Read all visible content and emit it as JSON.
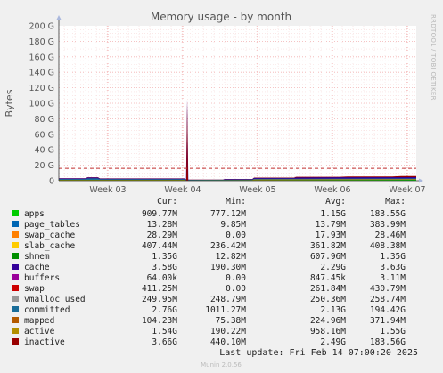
{
  "chart_data": {
    "type": "area",
    "title": "Memory usage - by month",
    "ylabel": "Bytes",
    "ylim": [
      0,
      200
    ],
    "y_unit": "G",
    "y_ticks": [
      "0",
      "20 G",
      "40 G",
      "60 G",
      "80 G",
      "100 G",
      "120 G",
      "140 G",
      "160 G",
      "180 G",
      "200 G"
    ],
    "x_ticks": [
      "Week 03",
      "Week 04",
      "Week 05",
      "Week 06",
      "Week 07"
    ],
    "threshold_line": 16,
    "grid": true,
    "side_label": "RRDTOOL / TOBI OETIKER",
    "columns": [
      "Cur:",
      "Min:",
      "Avg:",
      "Max:"
    ],
    "series": [
      {
        "name": "apps",
        "color": "#00cc00",
        "cur": "909.77M",
        "min": "777.12M",
        "avg": "1.15G",
        "max": "183.55G"
      },
      {
        "name": "page_tables",
        "color": "#0066b3",
        "cur": "13.28M",
        "min": "9.85M",
        "avg": "13.79M",
        "max": "383.99M"
      },
      {
        "name": "swap_cache",
        "color": "#ff8000",
        "cur": "28.29M",
        "min": "0.00",
        "avg": "17.93M",
        "max": "28.46M"
      },
      {
        "name": "slab_cache",
        "color": "#ffcc00",
        "cur": "407.44M",
        "min": "236.42M",
        "avg": "361.82M",
        "max": "408.38M"
      },
      {
        "name": "shmem",
        "color": "#008f00",
        "cur": "1.35G",
        "min": "12.82M",
        "avg": "607.96M",
        "max": "1.35G"
      },
      {
        "name": "cache",
        "color": "#330099",
        "cur": "3.58G",
        "min": "190.30M",
        "avg": "2.29G",
        "max": "3.63G"
      },
      {
        "name": "buffers",
        "color": "#990099",
        "cur": "64.00k",
        "min": "0.00",
        "avg": "847.45k",
        "max": "3.11M"
      },
      {
        "name": "swap",
        "color": "#cc0000",
        "cur": "411.25M",
        "min": "0.00",
        "avg": "261.84M",
        "max": "430.79M"
      },
      {
        "name": "vmalloc_used",
        "color": "#999999",
        "cur": "249.95M",
        "min": "248.79M",
        "avg": "250.36M",
        "max": "258.74M"
      },
      {
        "name": "committed",
        "color": "#1a6d99",
        "cur": "2.76G",
        "min": "1011.27M",
        "avg": "2.13G",
        "max": "194.42G"
      },
      {
        "name": "mapped",
        "color": "#b35a00",
        "cur": "104.23M",
        "min": "75.38M",
        "avg": "224.96M",
        "max": "371.94M"
      },
      {
        "name": "active",
        "color": "#b38f00",
        "cur": "1.54G",
        "min": "190.22M",
        "avg": "958.16M",
        "max": "1.55G"
      },
      {
        "name": "inactive",
        "color": "#990000",
        "cur": "3.66G",
        "min": "440.10M",
        "avg": "2.49G",
        "max": "183.56G"
      }
    ],
    "last_update": "Last update: Fri Feb 14 07:00:20 2025",
    "footer": "Munin 2.0.56"
  }
}
